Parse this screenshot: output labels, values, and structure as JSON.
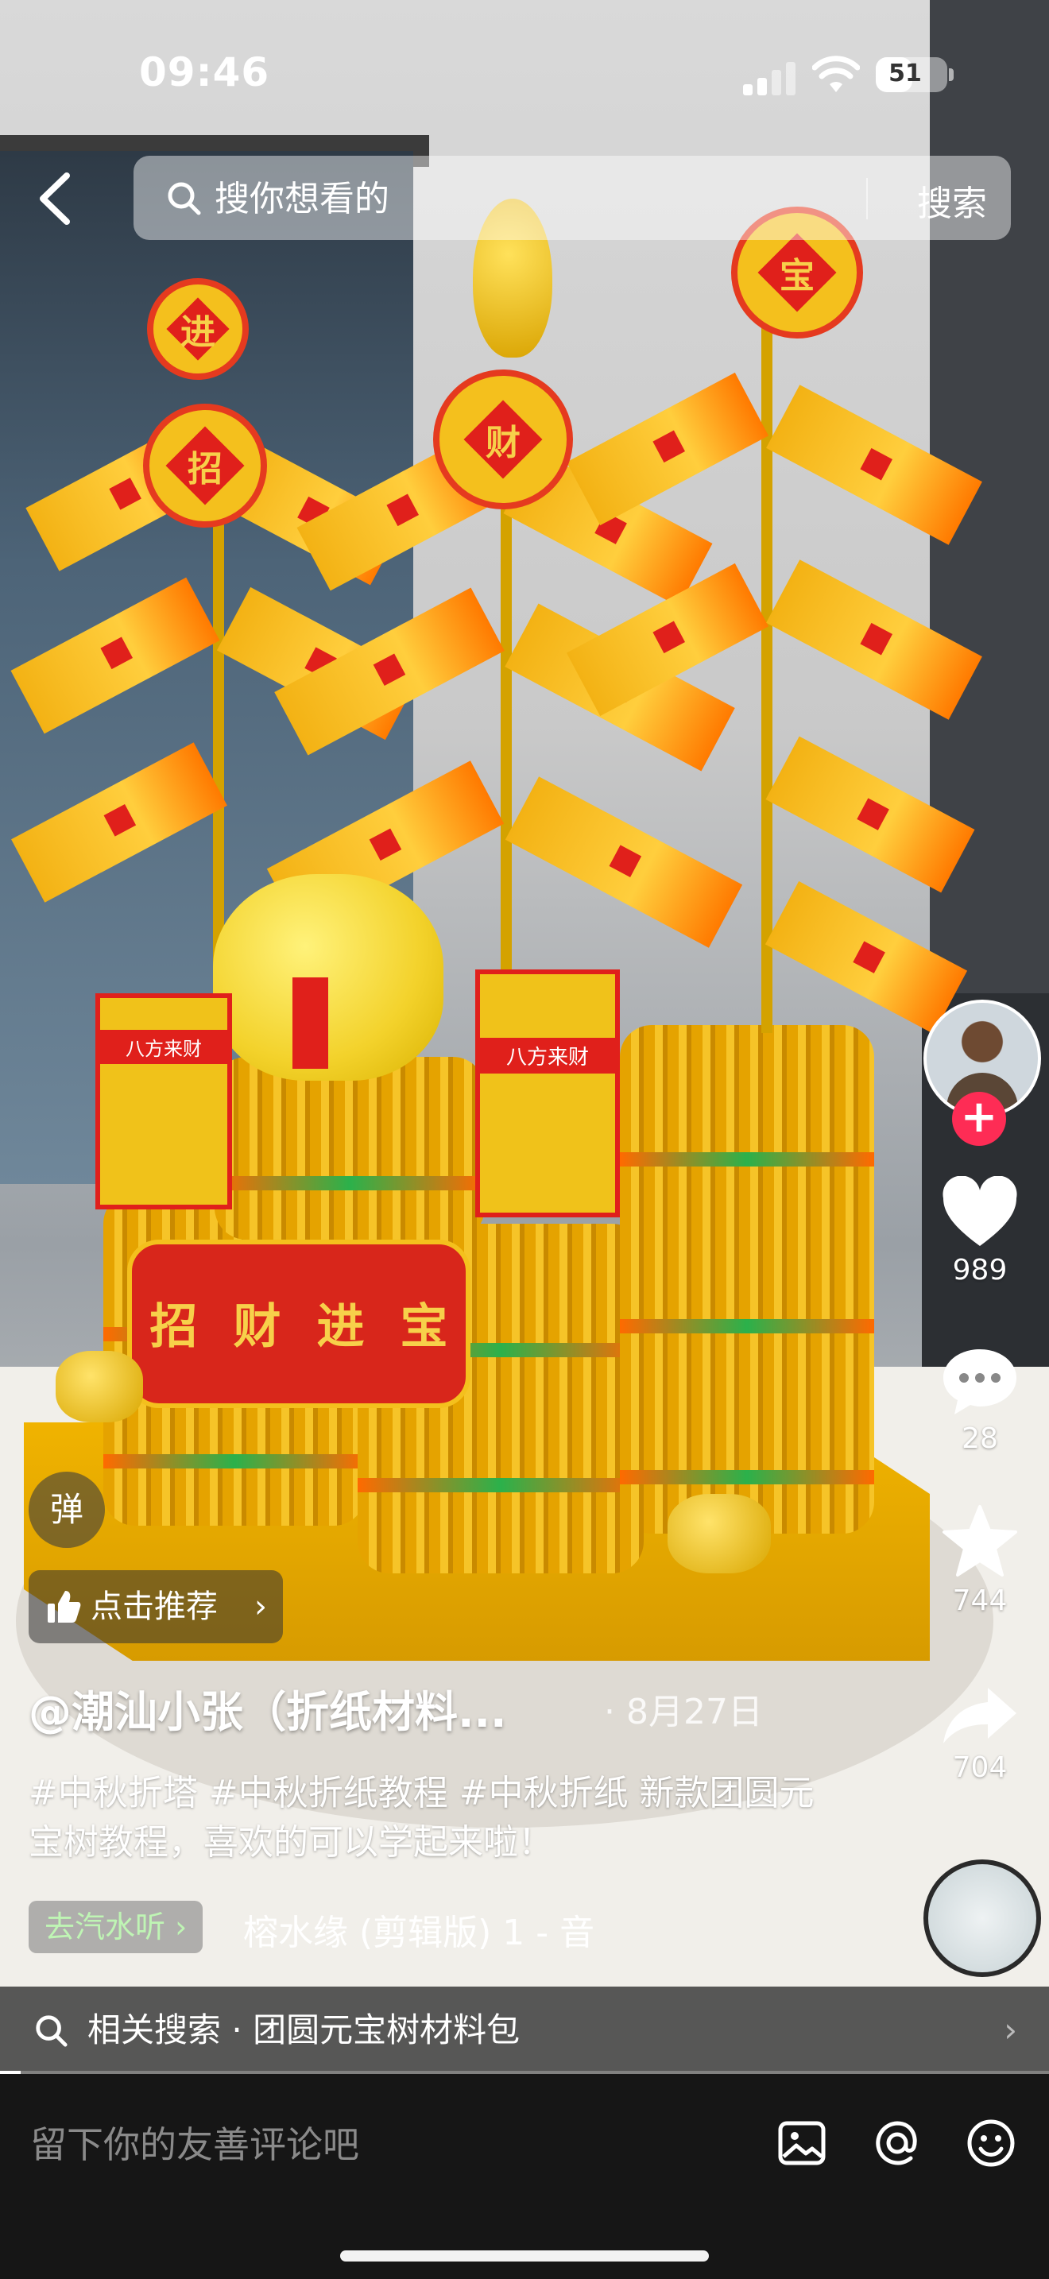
{
  "status_bar": {
    "time": "09:46",
    "battery": "51",
    "battery_level": 0.51
  },
  "search": {
    "placeholder": "搜你想看的",
    "button": "搜索"
  },
  "video_text": {
    "flag_chars": [
      "进",
      "招",
      "财",
      "宝"
    ],
    "card_label": "八方来财",
    "banner_chars": [
      "招",
      "财",
      "进",
      "宝"
    ]
  },
  "side_actions": {
    "like_count": "989",
    "comment_count": "28",
    "favorite_count": "744",
    "share_count": "704",
    "follow_symbol": "+"
  },
  "overlay": {
    "danmu": "弹",
    "recommend": "点击推荐",
    "recommend_chevron": "›"
  },
  "post": {
    "author": "@潮汕小张（折纸材料...",
    "date": "· 8月27日",
    "description": "#中秋折塔 #中秋折纸教程 #中秋折纸  新款团圆元宝树教程，喜欢的可以学起来啦！",
    "music_tag": "去汽水听",
    "music_tag_chevron": "›",
    "music_title": "榕水缘 (剪辑版) 1 - 音"
  },
  "related_search": {
    "prefix": "相关搜索",
    "separator": "·",
    "query": "团圆元宝树材料包",
    "chevron": "›"
  },
  "playback": {
    "progress": 0.02
  },
  "comment_bar": {
    "placeholder": "留下你的友善评论吧"
  },
  "icons": [
    "back-icon",
    "search-icon",
    "heart-icon",
    "comment-icon",
    "star-icon",
    "share-icon",
    "image-icon",
    "at-icon",
    "emoji-icon",
    "thumb-up-icon"
  ]
}
